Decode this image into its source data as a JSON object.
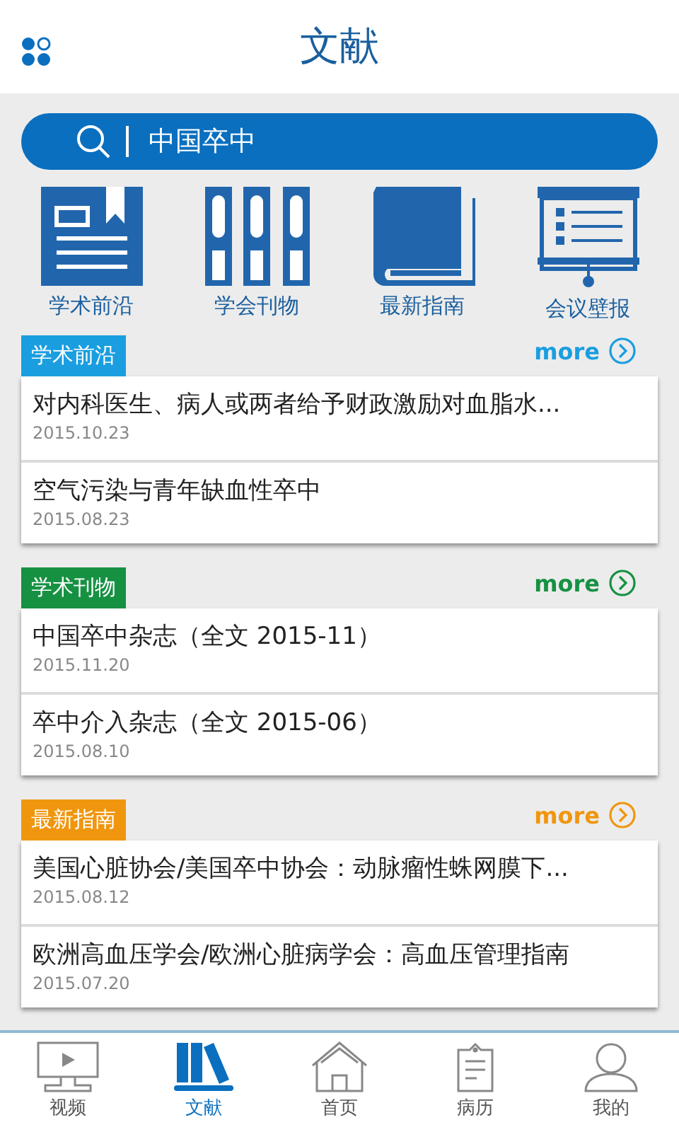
{
  "header": {
    "title": "文献"
  },
  "search": {
    "value": "中国卒中"
  },
  "categories": [
    {
      "kind": "newspaper",
      "label": "学术前沿"
    },
    {
      "kind": "binders",
      "label": "学会刊物"
    },
    {
      "kind": "book",
      "label": "最新指南"
    },
    {
      "kind": "board",
      "label": "会议壁报"
    }
  ],
  "sections": [
    {
      "tag": "学术前沿",
      "color": "#1a9ee0",
      "more": "more",
      "items": [
        {
          "title": "对内科医生、病人或两者给予财政激励对血脂水...",
          "date": "2015.10.23"
        },
        {
          "title": "空气污染与青年缺血性卒中",
          "date": "2015.08.23"
        }
      ]
    },
    {
      "tag": "学术刊物",
      "color": "#169142",
      "more": "more",
      "items": [
        {
          "title": "中国卒中杂志（全文 2015-11）",
          "date": "2015.11.20"
        },
        {
          "title": "卒中介入杂志（全文 2015-06）",
          "date": "2015.08.10"
        }
      ]
    },
    {
      "tag": "最新指南",
      "color": "#f0960e",
      "more": "more",
      "items": [
        {
          "title": "美国心脏协会/美国卒中协会：动脉瘤性蛛网膜下...",
          "date": "2015.08.12"
        },
        {
          "title": "欧洲高血压学会/欧洲心脏病学会：高血压管理指南",
          "date": "2015.07.20"
        }
      ]
    }
  ],
  "tabs": [
    {
      "kind": "video",
      "label": "视频",
      "selected": false
    },
    {
      "kind": "library",
      "label": "文献",
      "selected": true
    },
    {
      "kind": "home",
      "label": "首页",
      "selected": false
    },
    {
      "kind": "clipboard",
      "label": "病历",
      "selected": false
    },
    {
      "kind": "person",
      "label": "我的",
      "selected": false
    }
  ]
}
